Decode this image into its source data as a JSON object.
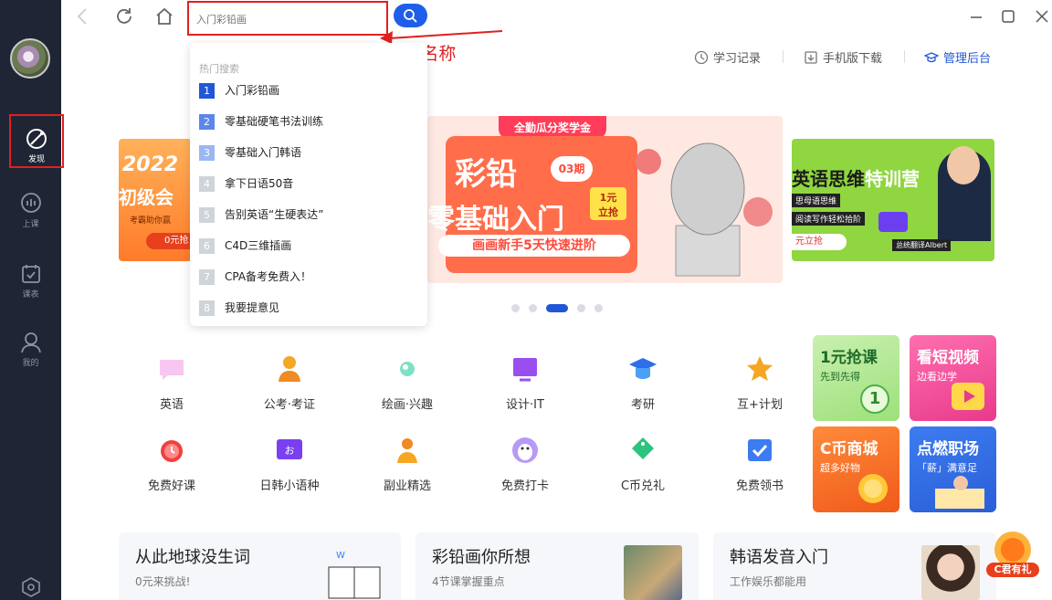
{
  "sidebar": {
    "items": [
      {
        "label": "发现",
        "icon": "compass-icon"
      },
      {
        "label": "上课",
        "icon": "live-class-icon"
      },
      {
        "label": "课表",
        "icon": "calendar-icon"
      },
      {
        "label": "我的",
        "icon": "user-icon"
      }
    ],
    "settings_icon": "hexagon-settings-icon"
  },
  "topbar": {
    "search_placeholder": "入门彩铅画",
    "annotation": "搜索课程号/课程名称"
  },
  "toplinks": {
    "study_record": "学习记录",
    "mobile_download": "手机版下载",
    "admin": "管理后台"
  },
  "dropdown": {
    "title": "热门搜索",
    "items": [
      {
        "num": "1",
        "label": "入门彩铅画"
      },
      {
        "num": "2",
        "label": "零基础硬笔书法训练"
      },
      {
        "num": "3",
        "label": "零基础入门韩语"
      },
      {
        "num": "4",
        "label": "拿下日语50音"
      },
      {
        "num": "5",
        "label": "告别英语“生硬表达”"
      },
      {
        "num": "6",
        "label": "C4D三维插画"
      },
      {
        "num": "7",
        "label": "CPA备考免费入！"
      },
      {
        "num": "8",
        "label": "我要提意见"
      }
    ]
  },
  "banners": {
    "left": {
      "line1": "2022",
      "line2": "初级会",
      "line3": "考霸助你赢",
      "cta": "0元抢"
    },
    "center": {
      "badge": "全勤瓜分奖学金",
      "title1": "彩铅",
      "issue": "03期",
      "title2": "零基础入门",
      "price": "1元",
      "price2": "立抢",
      "subtitle": "画画新手5天快速进阶"
    },
    "right": {
      "title1": "英语思维",
      "title2": "特训营",
      "line1": "思母语思维",
      "line2": "阅读写作轻松拾阶",
      "cta": "元立抢",
      "teacher": "总统翻译Albert"
    }
  },
  "categories": [
    {
      "label": "英语",
      "icon": "chat-bubble-icon"
    },
    {
      "label": "公考·考证",
      "icon": "exam-person-icon"
    },
    {
      "label": "绘画·兴趣",
      "icon": "paint-drop-icon"
    },
    {
      "label": "设计·IT",
      "icon": "monitor-icon"
    },
    {
      "label": "考研",
      "icon": "graduation-cap-icon"
    },
    {
      "label": "互+计划",
      "icon": "star-icon"
    },
    {
      "label": "免费好课",
      "icon": "alarm-clock-icon"
    },
    {
      "label": "日韩小语种",
      "icon": "speech-screen-icon"
    },
    {
      "label": "副业精选",
      "icon": "people-group-icon"
    },
    {
      "label": "免费打卡",
      "icon": "penguin-icon"
    },
    {
      "label": "C币兑礼",
      "icon": "gift-tag-icon"
    },
    {
      "label": "免费领书",
      "icon": "checkbox-book-icon"
    }
  ],
  "tiles": [
    {
      "title": "1元抢课",
      "sub": "先到先得",
      "badge": "1"
    },
    {
      "title": "看短视频",
      "sub": "边看边学"
    },
    {
      "title": "C币商城",
      "sub": "超多好物"
    },
    {
      "title": "点燃职场",
      "sub": "「薪」满意足"
    }
  ],
  "cards": [
    {
      "title": "从此地球没生词",
      "sub": "0元来挑战!"
    },
    {
      "title": "彩铅画你所想",
      "sub": "4节课掌握重点"
    },
    {
      "title": "韩语发音入门",
      "sub": "工作娱乐都能用"
    }
  ],
  "mascot": {
    "label": "C君有礼"
  },
  "colors": {
    "accent": "#1f5ee8",
    "annotation": "#e02020",
    "sidebar": "#1f2534"
  }
}
